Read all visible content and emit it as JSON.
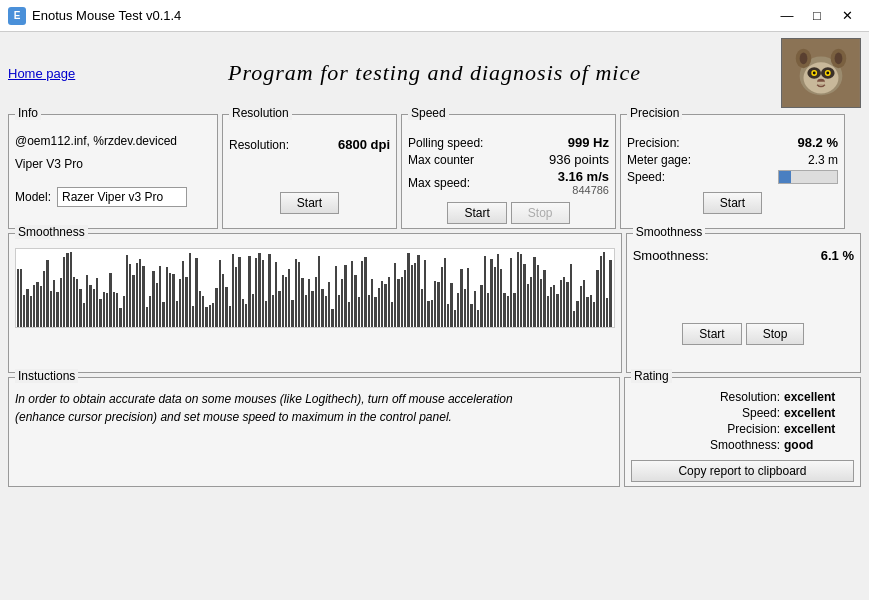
{
  "window": {
    "title": "Enotus Mouse Test v0.1.4",
    "controls": {
      "minimize": "—",
      "maximize": "□",
      "close": "✕"
    }
  },
  "header": {
    "home_link": "Home page",
    "app_title": "Program for testing and diagnosis of mice"
  },
  "info_panel": {
    "title": "Info",
    "device_text_line1": "@oem112.inf, %rzdev.deviced",
    "device_text_line2": "Viper V3 Pro",
    "model_label": "Model:",
    "model_value": "Razer Viper v3 Pro"
  },
  "resolution_panel": {
    "title": "Resolution",
    "resolution_label": "Resolution:",
    "resolution_value": "6800 dpi",
    "start_label": "Start"
  },
  "speed_panel": {
    "title": "Speed",
    "polling_label": "Polling speed:",
    "polling_value": "999 Hz",
    "max_counter_label": "Max counter",
    "max_counter_value": "936 points",
    "max_speed_label": "Max speed:",
    "max_speed_value": "3.16 m/s",
    "max_speed_sub": "844786",
    "start_label": "Start",
    "stop_label": "Stop"
  },
  "precision_panel": {
    "title": "Precision",
    "precision_label": "Precision:",
    "precision_value": "98.2 %",
    "meter_label": "Meter gage:",
    "meter_value": "2.3 m",
    "speed_label": "Speed:",
    "start_label": "Start",
    "speed_bar_pct": 20
  },
  "smoothness_panel": {
    "title": "Smoothness",
    "smoothness_label": "Smoothness:",
    "smoothness_value": "6.1 %",
    "start_label": "Start",
    "stop_label": "Stop"
  },
  "instructions_panel": {
    "title": "Instuctions",
    "text_line1": "In order to obtain accurate data on some mouses (like Logithech), turn off mouse acceleration",
    "text_line2": "(enhance cursor precision) and set mouse speed to maximum in the control panel."
  },
  "rating_panel": {
    "title": "Rating",
    "resolution_label": "Resolution:",
    "resolution_value": "excellent",
    "speed_label": "Speed:",
    "speed_value": "excellent",
    "precision_label": "Precision:",
    "precision_value": "excellent",
    "smoothness_label": "Smoothness:",
    "smoothness_value": "good",
    "copy_label": "Copy report to clipboard"
  }
}
